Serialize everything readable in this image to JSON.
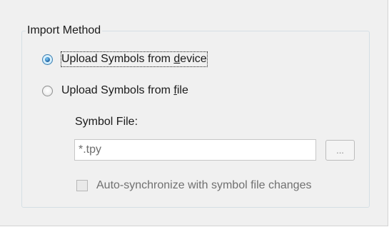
{
  "import_method": {
    "legend": "Import Method",
    "options": [
      {
        "label_before": "Upload Symbols from ",
        "label_mnemonic": "d",
        "label_after": "evice",
        "checked": true,
        "focused": true
      },
      {
        "label_before": "Upload Symbols from ",
        "label_mnemonic": "f",
        "label_after": "ile",
        "checked": false,
        "focused": false
      }
    ],
    "symbol_file": {
      "label": "Symbol File:",
      "value": "*.tpy",
      "enabled": false,
      "browse_label": "..."
    },
    "auto_sync": {
      "label": "Auto-synchronize with symbol file changes",
      "checked": false,
      "enabled": false
    }
  }
}
